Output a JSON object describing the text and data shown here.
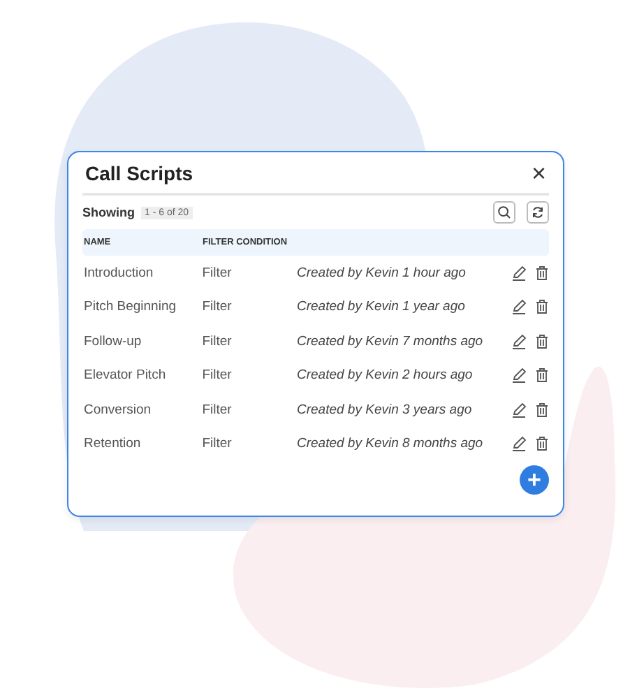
{
  "dialog": {
    "title": "Call Scripts",
    "close": "×"
  },
  "toolbar": {
    "label": "Showing",
    "range": "1 - 6 of 20"
  },
  "table": {
    "columns": [
      "NAME",
      "FILTER CONDITION"
    ],
    "rows": [
      {
        "name": "Introduction",
        "filter": "Filter",
        "created": "Created by Kevin 1 hour ago"
      },
      {
        "name": "Pitch Beginning",
        "filter": "Filter",
        "created": "Created by Kevin 1 year ago"
      },
      {
        "name": "Follow-up",
        "filter": "Filter",
        "created": "Created by Kevin 7 months ago"
      },
      {
        "name": "Elevator Pitch",
        "filter": "Filter",
        "created": "Created by Kevin 2 hours ago"
      },
      {
        "name": "Conversion",
        "filter": "Filter",
        "created": "Created by Kevin 3 years ago"
      },
      {
        "name": "Retention",
        "filter": "Filter",
        "created": "Created by Kevin 8 months ago"
      }
    ]
  },
  "add_button": {
    "label": "+"
  }
}
